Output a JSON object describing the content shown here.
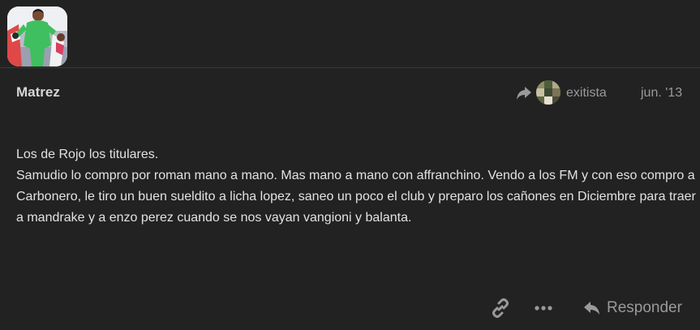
{
  "post": {
    "username": "Matrez",
    "reply_to_user": "exitista",
    "date": "jun. '13",
    "body_lines": [
      "Los de Rojo los titulares.",
      "Samudio lo compro por roman mano a mano. Mas mano a mano con affranchino. Vendo a los FM y con eso compro a Carbonero, le tiro un buen sueldito a licha lopez, saneo un poco el club y preparo los cañones en Diciembre para traer a mandrake y a enzo perez cuando se nos vayan vangioni y balanta."
    ]
  },
  "actions": {
    "reply_label": "Responder"
  },
  "icons": {
    "reply_to": "share-arrow-icon",
    "link": "link-icon",
    "more": "ellipsis-icon",
    "reply": "reply-icon"
  },
  "colors": {
    "background": "#222222",
    "text": "#e2e2e2",
    "muted": "#9a9a9a",
    "avatar_jersey": "#3fbf5f"
  }
}
